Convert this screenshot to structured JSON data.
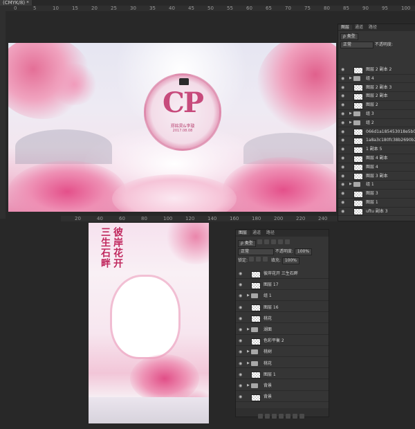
{
  "document": {
    "tab_title": "(CMYK/8) *"
  },
  "top_ruler": {
    "ticks": [
      "0",
      "5",
      "10",
      "15",
      "20",
      "25",
      "30",
      "35",
      "40",
      "45",
      "50",
      "55",
      "60",
      "65",
      "70",
      "75",
      "80",
      "85",
      "90",
      "95",
      "100"
    ]
  },
  "mid_ruler": {
    "ticks": [
      "20",
      "40",
      "60",
      "80",
      "100",
      "120",
      "140",
      "160",
      "180",
      "200",
      "220",
      "240"
    ]
  },
  "emblem": {
    "initials": "CP",
    "names": "郑銘昊&李璇",
    "date": "2017.08.08"
  },
  "poster": {
    "line_right": "彼岸花开",
    "line_left": "三生石畔"
  },
  "layers_panel_1": {
    "tabs": [
      "图层",
      "通道",
      "路径"
    ],
    "kind_label": "ρ 类型",
    "blend_mode": "正常",
    "opacity_label": "不透明度:",
    "layers": [
      {
        "name": "图层 2 副本 2",
        "type": "layer"
      },
      {
        "name": "组 4",
        "type": "group"
      },
      {
        "name": "图层 2 副本 3",
        "type": "layer"
      },
      {
        "name": "图层 2 副本",
        "type": "layer"
      },
      {
        "name": "图层 2",
        "type": "layer"
      },
      {
        "name": "组 3",
        "type": "group"
      },
      {
        "name": "组 2",
        "type": "group"
      },
      {
        "name": "066d1a185453018e5b01...",
        "type": "layer"
      },
      {
        "name": "1a8a3c180fc38b2690b24...",
        "type": "layer"
      },
      {
        "name": "1 副本 5",
        "type": "layer"
      },
      {
        "name": "图层 4 副本",
        "type": "layer"
      },
      {
        "name": "图层 4",
        "type": "layer"
      },
      {
        "name": "图层 3 副本",
        "type": "layer"
      },
      {
        "name": "组 1",
        "type": "group"
      },
      {
        "name": "图层 3",
        "type": "layer"
      },
      {
        "name": "图层 1",
        "type": "layer"
      },
      {
        "name": "uftu 副本 3",
        "type": "layer"
      }
    ]
  },
  "layers_panel_2": {
    "tabs": [
      "图层",
      "通道",
      "路径"
    ],
    "kind_label": "ρ 类型",
    "blend_mode": "正常",
    "opacity_label": "不透明度:",
    "opacity_value": "100%",
    "lock_label": "锁定:",
    "fill_label": "填充:",
    "fill_value": "100%",
    "layers": [
      {
        "name": "彼岸花开    三生石畔",
        "type": "layer"
      },
      {
        "name": "图层 17",
        "type": "layer"
      },
      {
        "name": "组 1",
        "type": "group"
      },
      {
        "name": "图层 16",
        "type": "layer"
      },
      {
        "name": "桃花",
        "type": "layer"
      },
      {
        "name": "湖面",
        "type": "group"
      },
      {
        "name": "色彩平衡 2",
        "type": "layer"
      },
      {
        "name": "桃树",
        "type": "group"
      },
      {
        "name": "桃花",
        "type": "group"
      },
      {
        "name": "图层 1",
        "type": "layer"
      },
      {
        "name": "背景",
        "type": "group"
      },
      {
        "name": "背景",
        "type": "layer"
      }
    ]
  },
  "colors": {
    "panel_bg": "#353535",
    "app_bg": "#282828",
    "accent_pink": "#c0285e"
  }
}
